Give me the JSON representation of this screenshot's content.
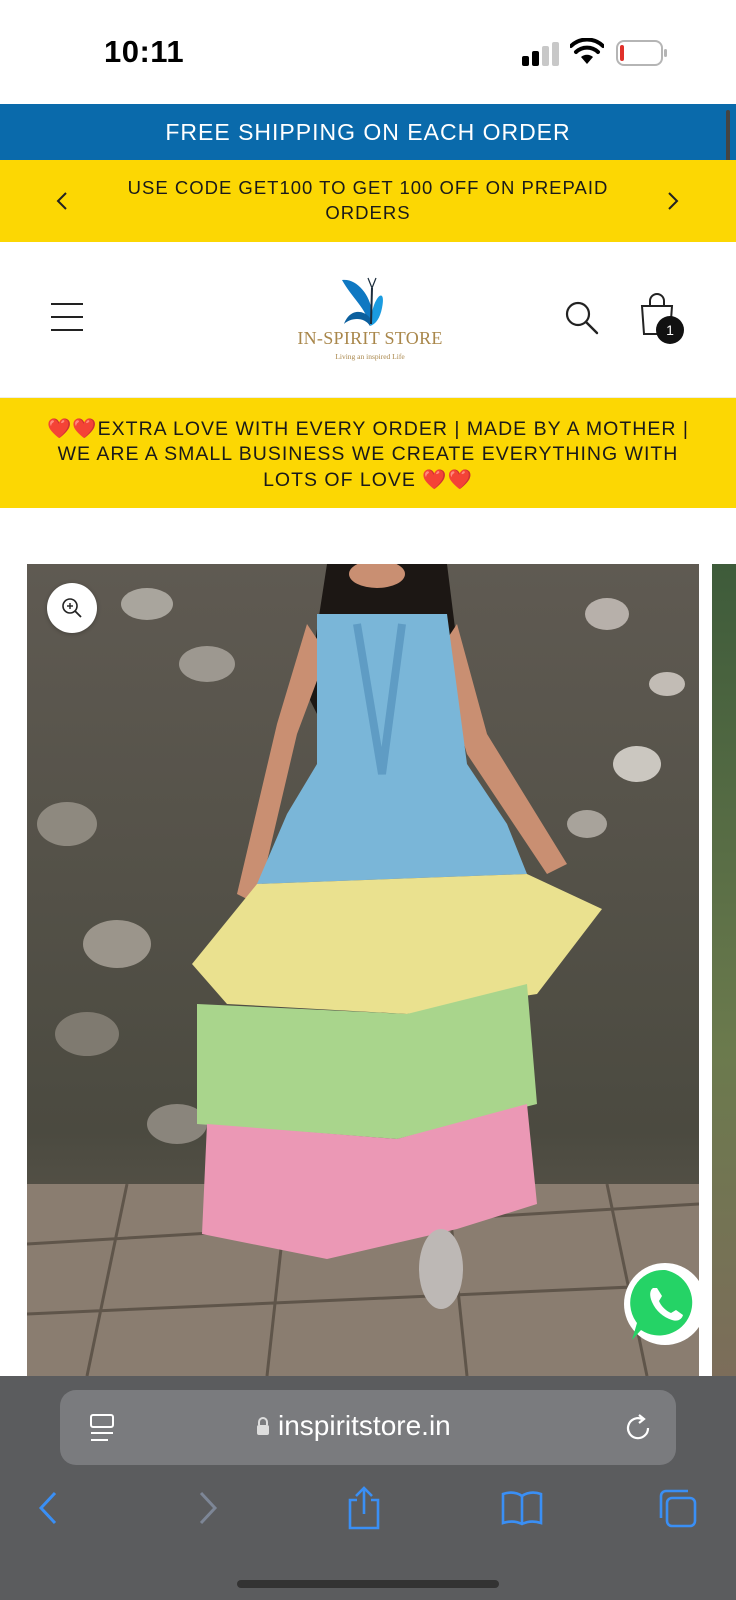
{
  "status_bar": {
    "time": "10:11"
  },
  "shipping_banner": {
    "text": "FREE SHIPPING ON EACH ORDER"
  },
  "promo_banner": {
    "text": "USE CODE GET100 TO GET 100 OFF ON PREPAID ORDERS"
  },
  "header": {
    "logo_name": "IN-SPIRIT STORE",
    "logo_tagline": "Living an inspired Life",
    "cart_count": "1"
  },
  "love_banner": {
    "text": "EXTRA LOVE WITH EVERY ORDER | MADE BY A MOTHER | WE ARE A SMALL BUSINESS WE CREATE EVERYTHING WITH LOTS OF LOVE",
    "heart_glyph": "❤️"
  },
  "browser": {
    "url": "inspiritstore.in"
  },
  "colors": {
    "shipping_bar": "#0a6aab",
    "promo_yellow": "#fcd703",
    "browser_chrome": "#5b5c5e",
    "ios_blue": "#3a8ff5",
    "whatsapp_green": "#25d366"
  },
  "icons": [
    "menu-icon",
    "search-icon",
    "cart-icon",
    "zoom-in-icon",
    "whatsapp-icon",
    "reader-icon",
    "lock-icon",
    "reload-icon",
    "back-icon",
    "forward-icon",
    "share-icon",
    "bookmarks-icon",
    "tabs-icon"
  ]
}
